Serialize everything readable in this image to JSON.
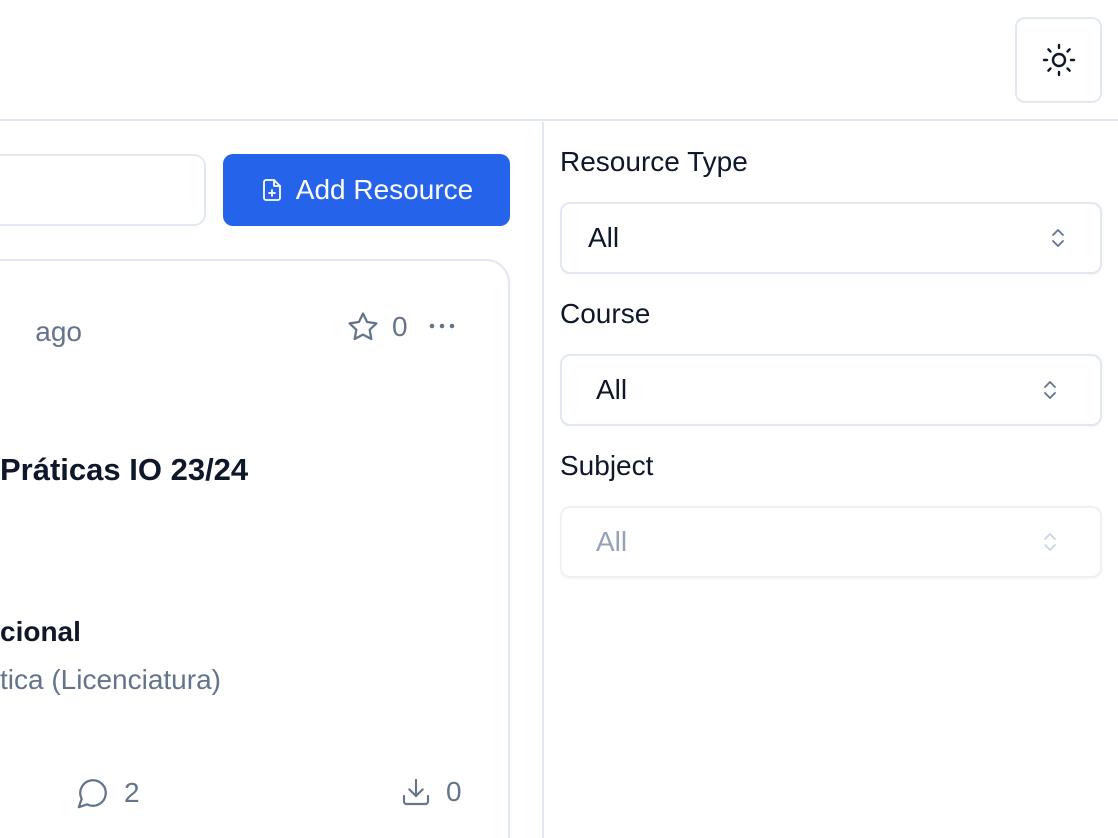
{
  "header": {
    "theme_toggle_icon": "sun-icon"
  },
  "toolbar": {
    "search_value": "",
    "add_resource_label": "Add Resource",
    "add_resource_icon": "file-plus-icon",
    "accent_color": "#2563eb"
  },
  "card": {
    "time_text": "es ago",
    "stars": "0",
    "title": "Práticas IO 23/24",
    "subject": "cional",
    "course": "tica (Licenciatura)",
    "comments": "2",
    "downloads": "0"
  },
  "filters": {
    "resource_type": {
      "label": "Resource Type",
      "value": "All"
    },
    "course": {
      "label": "Course",
      "value": "All"
    },
    "subject": {
      "label": "Subject",
      "value": "All",
      "disabled": true
    }
  }
}
